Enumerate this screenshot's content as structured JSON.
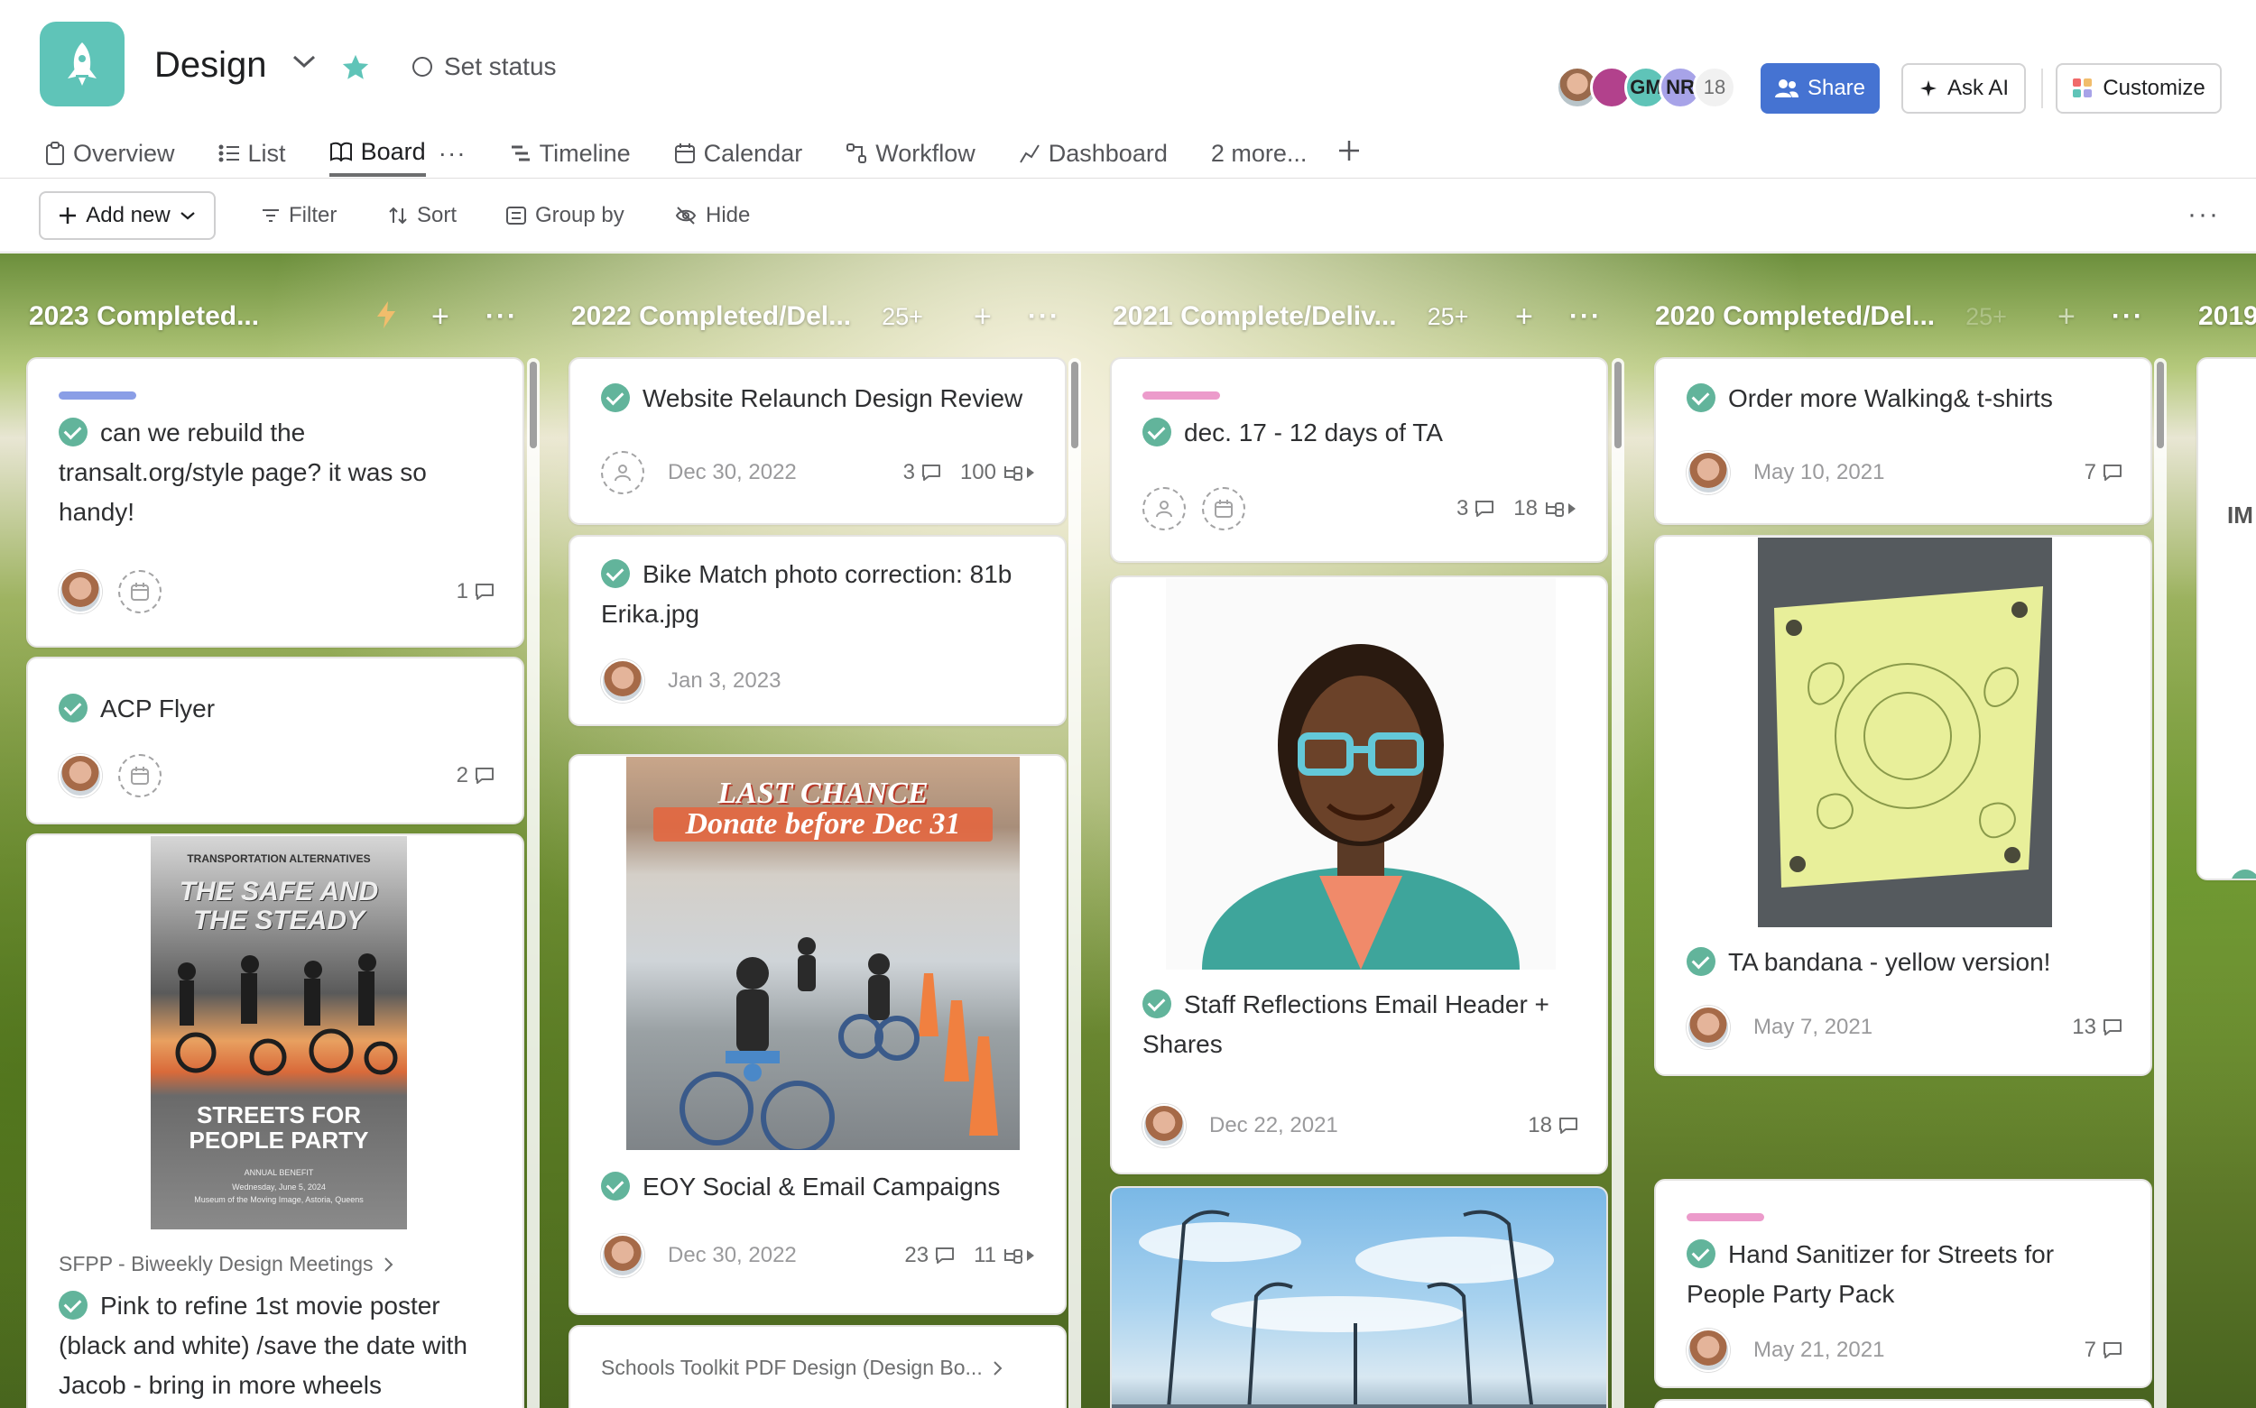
{
  "project": {
    "title": "Design",
    "icon": "rocket-icon",
    "set_status": "Set status",
    "color": "#5fc4b8"
  },
  "members": {
    "initials": [
      "GM",
      "NR"
    ],
    "extra_count": "18"
  },
  "actions": {
    "share": "Share",
    "ask_ai": "Ask AI",
    "customize": "Customize"
  },
  "tabs": [
    {
      "label": "Overview",
      "icon": "clipboard-icon"
    },
    {
      "label": "List",
      "icon": "list-icon"
    },
    {
      "label": "Board",
      "icon": "board-icon",
      "active": true
    },
    {
      "label": "Timeline",
      "icon": "timeline-icon"
    },
    {
      "label": "Calendar",
      "icon": "calendar-icon"
    },
    {
      "label": "Workflow",
      "icon": "workflow-icon"
    },
    {
      "label": "Dashboard",
      "icon": "chart-icon"
    },
    {
      "label": "2 more..."
    }
  ],
  "toolbar": {
    "add_new": "Add new",
    "filter": "Filter",
    "sort": "Sort",
    "group_by": "Group by",
    "hide": "Hide"
  },
  "columns": [
    {
      "title": "2023 Completed...",
      "count": "",
      "cards": [
        {
          "title": "can we rebuild the transalt.org/style page? it was so handy!",
          "pill_color": "#8a9ee6",
          "comments": "1"
        },
        {
          "title": "ACP Flyer",
          "comments": "2"
        },
        {
          "cover_lines": [
            "TRANSPORTATION ALTERNATIVES",
            "THE SAFE AND THE STEADY",
            "STREETS FOR PEOPLE PARTY",
            "ANNUAL BENEFIT",
            "Wednesday, June 5, 2024",
            "Museum of the Moving Image, Astoria, Queens"
          ],
          "parent": "SFPP - Biweekly Design Meetings",
          "title": "Pink to refine 1st movie poster (black and white) /save the date with Jacob - bring in more wheels"
        }
      ]
    },
    {
      "title": "2022 Completed/Del...",
      "count": "25+",
      "cards": [
        {
          "title": "Website Relaunch Design Review",
          "date": "Dec 30, 2022",
          "comments": "3",
          "subtasks": "100"
        },
        {
          "title": "Bike Match photo correction: 81b Erika.jpg",
          "date": "Jan 3, 2023"
        },
        {
          "cover_lines": [
            "LAST CHANCE",
            "Donate before Dec 31"
          ],
          "title": "EOY Social & Email Campaigns",
          "date": "Dec 30, 2022",
          "comments": "23",
          "subtasks": "11"
        },
        {
          "parent": "Schools Toolkit PDF Design (Design Bo..."
        }
      ]
    },
    {
      "title": "2021 Complete/Deliv...",
      "count": "25+",
      "cards": [
        {
          "title": "dec. 17 - 12 days of TA",
          "pill_color": "#ec9bcb",
          "comments": "3",
          "subtasks": "18"
        },
        {
          "title": "Staff Reflections Email Header + Shares",
          "date": "Dec 22, 2021",
          "comments": "18"
        }
      ]
    },
    {
      "title": "2020 Completed/Del...",
      "count": "25+",
      "cards": [
        {
          "title": "Order more Walking& t-shirts",
          "date": "May 10, 2021",
          "comments": "7"
        },
        {
          "title": "TA bandana - yellow version!",
          "date": "May 7, 2021",
          "comments": "13"
        },
        {
          "title": "Hand Sanitizer for Streets for People Party Pack",
          "pill_color": "#ec9bcb",
          "date": "May 21, 2021",
          "comments": "7"
        }
      ]
    },
    {
      "title": "2019",
      "partial_text": "IM"
    }
  ]
}
